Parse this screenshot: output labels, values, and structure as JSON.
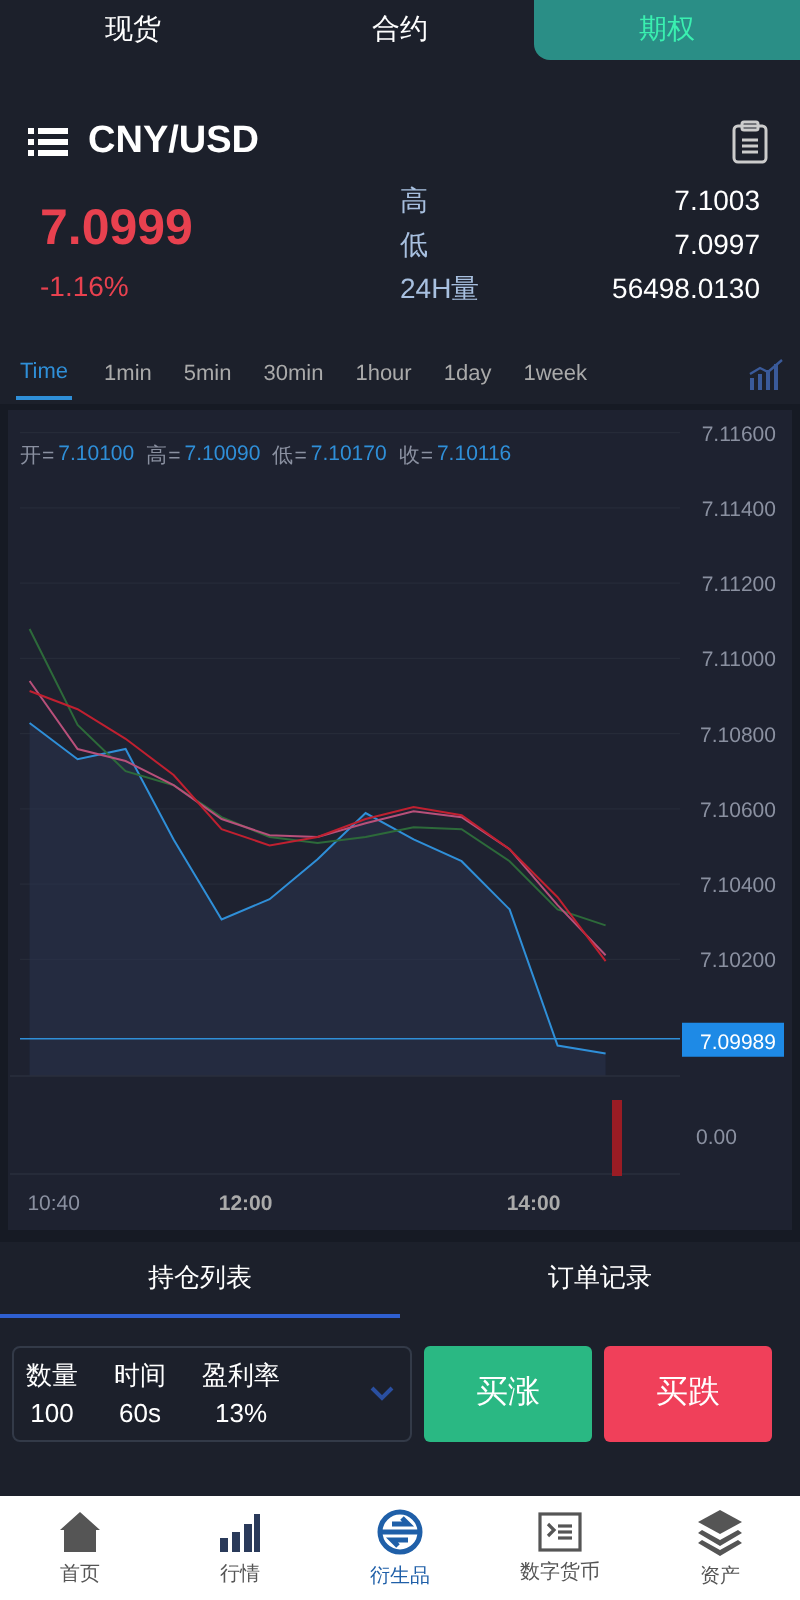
{
  "top_tabs": [
    {
      "label": "现货",
      "selected": false
    },
    {
      "label": "合约",
      "selected": false
    },
    {
      "label": "期权",
      "selected": true
    }
  ],
  "header": {
    "symbol": "CNY/USD"
  },
  "quote": {
    "price": "7.0999",
    "change": "-1.16%",
    "stats": [
      {
        "label": "高",
        "value": "7.1003"
      },
      {
        "label": "低",
        "value": "7.0997"
      },
      {
        "label": "24H量",
        "value": "56498.0130"
      }
    ]
  },
  "intervals": [
    {
      "label": "Time",
      "selected": true
    },
    {
      "label": "1min",
      "selected": false
    },
    {
      "label": "5min",
      "selected": false
    },
    {
      "label": "30min",
      "selected": false
    },
    {
      "label": "1hour",
      "selected": false
    },
    {
      "label": "1day",
      "selected": false
    },
    {
      "label": "1week",
      "selected": false
    }
  ],
  "chart": {
    "legend": [
      {
        "label": "开=",
        "value": "7.10100"
      },
      {
        "label": "高=",
        "value": "7.10090"
      },
      {
        "label": "低=",
        "value": "7.10170"
      },
      {
        "label": "收=",
        "value": "7.10116"
      }
    ],
    "chart_data": {
      "type": "line",
      "grid": true,
      "ref_lines": [
        {
          "axis": "y",
          "value": 7.09989,
          "label": "7.09989"
        }
      ],
      "x": [
        10.5,
        10.833,
        11.167,
        11.5,
        11.833,
        12.167,
        12.5,
        12.833,
        13.167,
        13.5,
        13.833,
        14.167,
        14.5
      ],
      "xlim": [
        10.433,
        15.017
      ],
      "ylim": [
        7.0989,
        7.1166
      ],
      "xticks": [
        {
          "value": 10.667,
          "label": "10:40"
        },
        {
          "value": 12,
          "label": "12:00"
        },
        {
          "value": 14,
          "label": "14:00"
        }
      ],
      "yticks": [
        {
          "value": 7.116,
          "label": "7.11600"
        },
        {
          "value": 7.114,
          "label": "7.11400"
        },
        {
          "value": 7.112,
          "label": "7.11200"
        },
        {
          "value": 7.11,
          "label": "7.11000"
        },
        {
          "value": 7.108,
          "label": "7.10800"
        },
        {
          "value": 7.106,
          "label": "7.10600"
        },
        {
          "value": 7.104,
          "label": "7.10400"
        },
        {
          "value": 7.102,
          "label": "7.10200"
        }
      ],
      "series": [
        {
          "color": "#2f8fd8",
          "values": [
            7.10828,
            7.10732,
            7.10759,
            7.10519,
            7.10306,
            7.1036,
            7.10466,
            7.10589,
            7.10519,
            7.10461,
            7.10333,
            7.09971,
            7.0995
          ]
        },
        {
          "color": "#2d6a3a",
          "values": [
            7.11078,
            7.10823,
            7.107,
            7.10663,
            7.10578,
            7.10525,
            7.10509,
            7.10525,
            7.10551,
            7.10546,
            7.10461,
            7.10333,
            7.1029
          ]
        },
        {
          "color": "#b8507a",
          "values": [
            7.1094,
            7.10759,
            7.10727,
            7.10663,
            7.10573,
            7.1053,
            7.10525,
            7.10562,
            7.10594,
            7.10578,
            7.10493,
            7.10344,
            7.10211
          ]
        },
        {
          "color": "#c02030",
          "values": [
            7.10913,
            7.10865,
            7.10786,
            7.1069,
            7.10546,
            7.10503,
            7.10525,
            7.10573,
            7.10605,
            7.10583,
            7.10493,
            7.10365,
            7.10195
          ]
        }
      ]
    },
    "volume_axis": "0.00"
  },
  "list_tabs": [
    {
      "label": "持仓列表",
      "selected": true
    },
    {
      "label": "订单记录",
      "selected": false
    }
  ],
  "order": {
    "fields": [
      {
        "label": "数量",
        "value": "100"
      },
      {
        "label": "时间",
        "value": "60s"
      },
      {
        "label": "盈利率",
        "value": "13%"
      }
    ],
    "buy_up": "买涨",
    "buy_down": "买跌"
  },
  "nav": [
    {
      "label": "首页",
      "kind": "home",
      "selected": false
    },
    {
      "label": "行情",
      "kind": "market",
      "selected": false
    },
    {
      "label": "衍生品",
      "kind": "derivatives",
      "selected": true
    },
    {
      "label": "数字货币",
      "kind": "crypto",
      "selected": false
    },
    {
      "label": "资产",
      "kind": "assets",
      "selected": false
    }
  ]
}
